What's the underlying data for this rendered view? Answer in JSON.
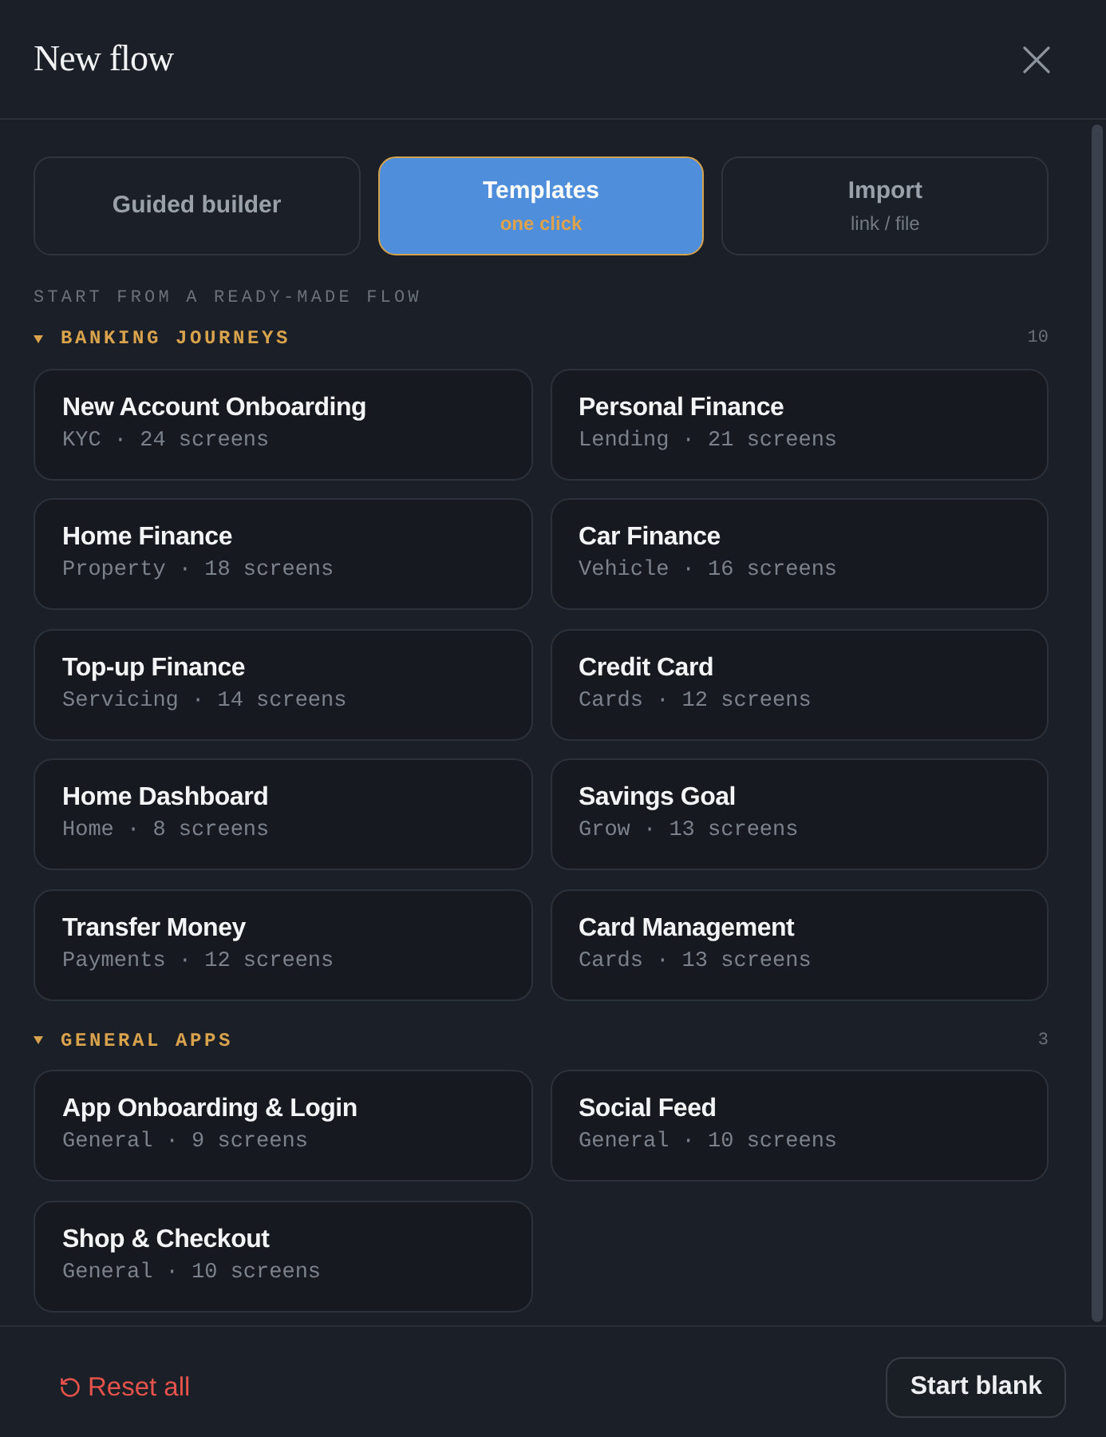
{
  "dialog": {
    "title": "New flow"
  },
  "modes": [
    {
      "label": "Guided builder",
      "selected": false
    },
    {
      "label": "Templates",
      "hint": "one click",
      "selected": true
    },
    {
      "label": "Import",
      "hint": "link / file",
      "selected": false
    }
  ],
  "section_title": "START FROM A READY-MADE FLOW",
  "groups": [
    {
      "title": "BANKING JOURNEYS",
      "count": "10",
      "expanded": true,
      "templates": [
        {
          "name": "New Account Onboarding",
          "meta": "KYC · 24 screens"
        },
        {
          "name": "Personal Finance",
          "meta": "Lending · 21 screens"
        },
        {
          "name": "Home Finance",
          "meta": "Property · 18 screens"
        },
        {
          "name": "Car Finance",
          "meta": "Vehicle · 16 screens"
        },
        {
          "name": "Top-up Finance",
          "meta": "Servicing · 14 screens"
        },
        {
          "name": "Credit Card",
          "meta": "Cards · 12 screens"
        },
        {
          "name": "Home Dashboard",
          "meta": "Home · 8 screens"
        },
        {
          "name": "Savings Goal",
          "meta": "Grow · 13 screens"
        },
        {
          "name": "Transfer Money",
          "meta": "Payments · 12 screens"
        },
        {
          "name": "Card Management",
          "meta": "Cards · 13 screens"
        }
      ]
    },
    {
      "title": "GENERAL APPS",
      "count": "3",
      "expanded": true,
      "templates": [
        {
          "name": "App Onboarding & Login",
          "meta": "General · 9 screens"
        },
        {
          "name": "Social Feed",
          "meta": "General · 10 screens"
        },
        {
          "name": "Shop & Checkout",
          "meta": "General · 10 screens"
        }
      ]
    }
  ],
  "footer": {
    "reset": "Reset all",
    "start": "Start blank"
  }
}
